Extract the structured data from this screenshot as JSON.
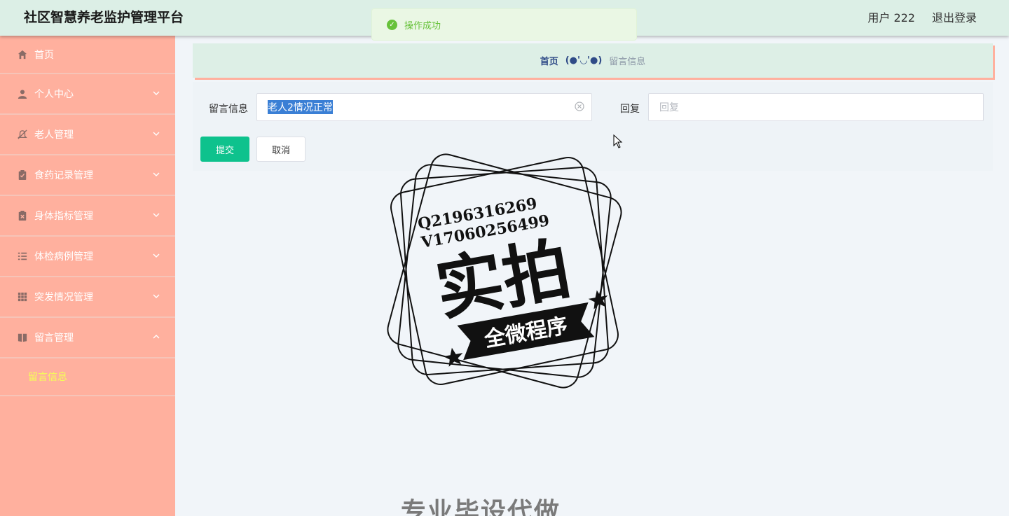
{
  "header": {
    "title": "社区智慧养老监护管理平台",
    "user": "用户 222",
    "logout": "退出登录"
  },
  "toast": {
    "message": "操作成功",
    "color": "#67c23a"
  },
  "sidebar": {
    "items": [
      {
        "label": "首页",
        "icon": "home-icon"
      },
      {
        "label": "个人中心",
        "icon": "person-icon",
        "chevron": "down"
      },
      {
        "label": "老人管理",
        "icon": "bell-off-icon",
        "chevron": "down"
      },
      {
        "label": "食药记录管理",
        "icon": "clipboard-check-icon",
        "chevron": "down"
      },
      {
        "label": "身体指标管理",
        "icon": "clipboard-x-icon",
        "chevron": "down"
      },
      {
        "label": "体检病例管理",
        "icon": "list-icon",
        "chevron": "down"
      },
      {
        "label": "突发情况管理",
        "icon": "grid-icon",
        "chevron": "down"
      },
      {
        "label": "留言管理",
        "icon": "book-icon",
        "chevron": "up"
      }
    ],
    "submenu": {
      "label": "留言信息"
    }
  },
  "breadcrumb": {
    "home": "首页",
    "separator": "(●'◡'●)",
    "current": "留言信息"
  },
  "form": {
    "message_label": "留言信息",
    "message_value": "老人2情况正常",
    "reply_label": "回复",
    "reply_placeholder": "回复",
    "submit": "提交",
    "cancel": "取消"
  },
  "watermark": {
    "line1": "Q2196316269",
    "line2": "V17060256499",
    "main": "实拍",
    "banner": "全微程序"
  },
  "bottom_text": "专业毕设代做",
  "colors": {
    "sidebar": "#ffb09e",
    "header": "#dcefe6",
    "primary": "#0ec28d",
    "submenu_active": "#f4ff57"
  }
}
